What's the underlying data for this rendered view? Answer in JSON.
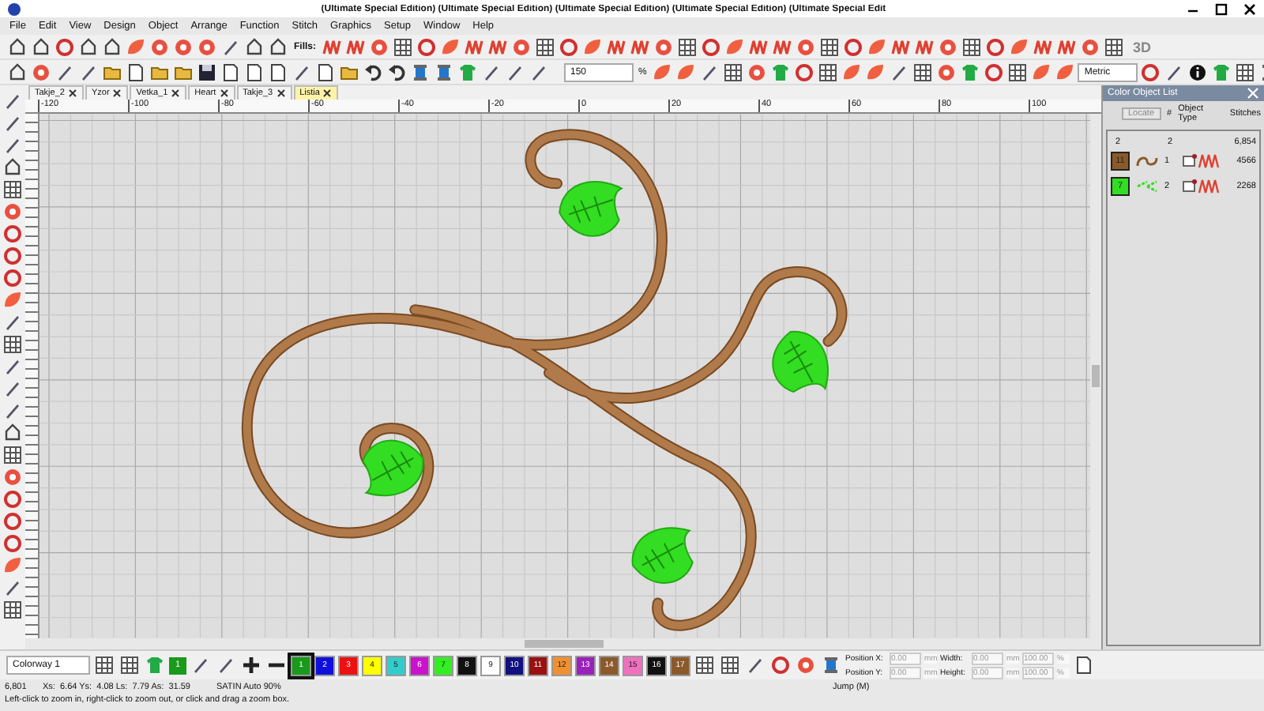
{
  "window": {
    "title": "(Ultimate Special Edition) (Ultimate Special Edition) (Ultimate Special Edition) (Ultimate Special Edition) (Ultimate Special Edit"
  },
  "menu": [
    "File",
    "Edit",
    "View",
    "Design",
    "Object",
    "Arrange",
    "Function",
    "Stitch",
    "Graphics",
    "Setup",
    "Window",
    "Help"
  ],
  "toolbar": {
    "fills_label": "Fills:",
    "view_3d": "3D",
    "zoom": "150",
    "zoom_unit": "%",
    "units": "Metric"
  },
  "tabs": [
    {
      "label": "Takje_2",
      "selected": false
    },
    {
      "label": "Yzor",
      "selected": false
    },
    {
      "label": "Vetka_1",
      "selected": false
    },
    {
      "label": "Heart",
      "selected": false
    },
    {
      "label": "Takje_3",
      "selected": false
    },
    {
      "label": "Listia",
      "selected": true
    }
  ],
  "ruler": [
    "-120",
    "-100",
    "-80",
    "-60",
    "-40",
    "-20",
    "0",
    "20",
    "40",
    "60",
    "80",
    "100"
  ],
  "object_list": {
    "title": "Color Object List",
    "columns": [
      "Locate",
      "#",
      "Object Type",
      "Stitches"
    ],
    "summary": [
      "2",
      "2",
      "6,854"
    ],
    "rows": [
      {
        "badge": "11",
        "color": "#8b5a2b",
        "number": "1",
        "stitches": "4566"
      },
      {
        "badge": "7",
        "color": "#33dd22",
        "number": "2",
        "stitches": "2268"
      }
    ]
  },
  "colorway": {
    "value": "Colorway 1",
    "current": "1",
    "color": "#1a9a1a"
  },
  "palette": [
    {
      "label": "1",
      "color": "#1a9a1a",
      "selected": true
    },
    {
      "label": "2",
      "color": "#1010dd",
      "selected": false
    },
    {
      "label": "3",
      "color": "#ee1111",
      "selected": false
    },
    {
      "label": "4",
      "color": "#ffff00",
      "selected": false
    },
    {
      "label": "5",
      "color": "#33cccc",
      "selected": false
    },
    {
      "label": "6",
      "color": "#cc11cc",
      "selected": false
    },
    {
      "label": "7",
      "color": "#33ee22",
      "selected": false
    },
    {
      "label": "8",
      "color": "#111111",
      "selected": false
    },
    {
      "label": "9",
      "color": "#ffffff",
      "selected": false
    },
    {
      "label": "10",
      "color": "#101080",
      "selected": false
    },
    {
      "label": "11",
      "color": "#991111",
      "selected": false
    },
    {
      "label": "12",
      "color": "#f09030",
      "selected": false
    },
    {
      "label": "13",
      "color": "#9922bb",
      "selected": false
    },
    {
      "label": "14",
      "color": "#8b5a2b",
      "selected": false
    },
    {
      "label": "15",
      "color": "#f070c0",
      "selected": false
    },
    {
      "label": "16",
      "color": "#111111",
      "selected": false
    },
    {
      "label": "17",
      "color": "#8b5a2b",
      "selected": false
    }
  ],
  "transform": [
    {
      "disabled": true,
      "label": "Position X:",
      "value": "0.00",
      "unit": "mm",
      "label2": "Width:",
      "value2": "0.00",
      "unit2": "mm",
      "scale": "100.00",
      "scale_unit": "%"
    },
    {
      "disabled": true,
      "label": "Position Y:",
      "value": "0.00",
      "unit": "mm",
      "label2": "Height:",
      "value2": "0.00",
      "unit2": "mm",
      "scale": "100.00",
      "scale_unit": "%"
    }
  ],
  "status": {
    "count": "6,801",
    "coords": "Xs:  6.64 Ys:  4.08 Ls:  7.79 As:  31.59",
    "stitch": "SATIN Auto 90%",
    "mode": "Jump (M)",
    "hint": "Left-click to zoom in, right-click to zoom out, or click and drag a zoom box."
  }
}
